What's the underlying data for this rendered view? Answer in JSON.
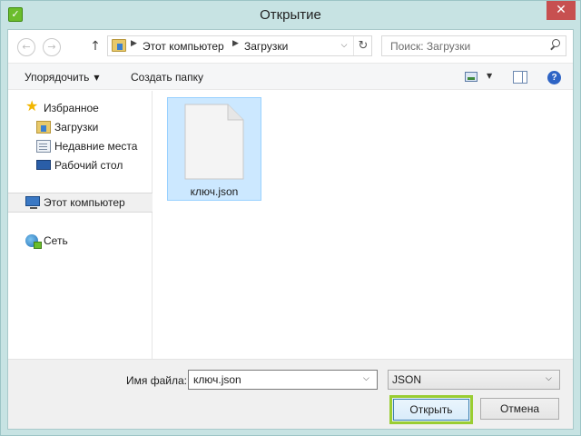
{
  "window": {
    "title": "Открытие",
    "close_glyph": "✕",
    "app_icon_glyph": "✓",
    "accent": "#c7e3e3",
    "close_color": "#c75050"
  },
  "address_bar": {
    "back_glyph": "←",
    "forward_glyph": "→",
    "up_glyph": "↑",
    "crumbs": [
      "Этот компьютер",
      "Загрузки"
    ],
    "separator_glyph": "▶",
    "dropdown_glyph": "⌵",
    "refresh_glyph": "↻"
  },
  "search": {
    "placeholder": "Поиск: Загрузки"
  },
  "toolbar": {
    "organize_label": "Упорядочить",
    "new_folder_label": "Создать папку",
    "caret_glyph": "▼"
  },
  "nav_pane": {
    "items": [
      {
        "label": "Избранное",
        "icon": "star-icon"
      },
      {
        "label": "Загрузки",
        "icon": "downloads-folder-icon"
      },
      {
        "label": "Недавние места",
        "icon": "recent-places-icon"
      },
      {
        "label": "Рабочий стол",
        "icon": "desktop-icon"
      },
      {
        "label": "Этот компьютер",
        "icon": "computer-icon",
        "selected": true
      },
      {
        "label": "Сеть",
        "icon": "network-icon"
      }
    ]
  },
  "files": [
    {
      "name": "ключ.json",
      "selected": true,
      "icon": "document-icon"
    }
  ],
  "bottom": {
    "filename_label": "Имя файла:",
    "filename_value": "ключ.json",
    "filetype_value": "JSON",
    "combo_caret": "⌵",
    "open_label": "Открыть",
    "cancel_label": "Отмена",
    "open_highlight": "#9acd32"
  }
}
